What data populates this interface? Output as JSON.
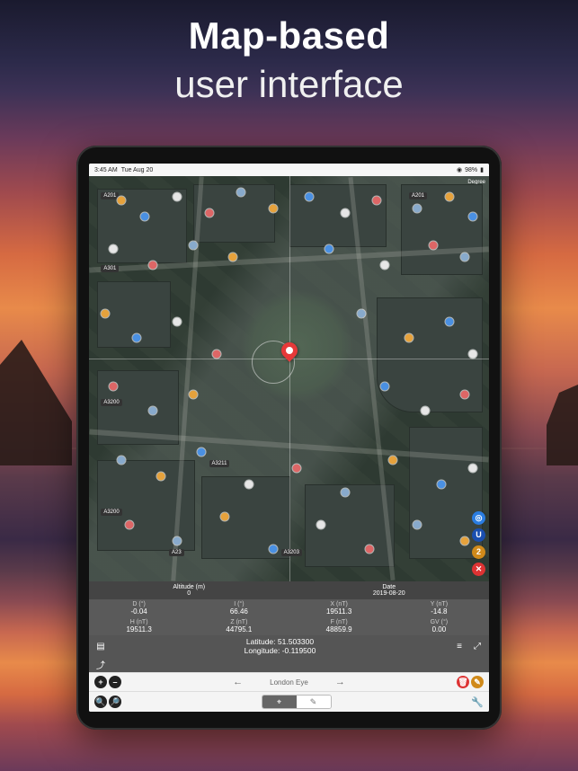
{
  "promo": {
    "title": "Map-based",
    "subtitle": "user interface"
  },
  "status": {
    "time": "3:45 AM",
    "date": "Tue Aug 20",
    "battery": "98%"
  },
  "map": {
    "degree_label": "Degree",
    "road_badges": [
      "A201",
      "A301",
      "A201",
      "A3200",
      "A23",
      "A3203",
      "A3211",
      "A3200"
    ],
    "center_label": "London Eye",
    "side_buttons": {
      "locate": "◎",
      "layers": "U",
      "record": "2",
      "close": "✕"
    }
  },
  "panel": {
    "altitude_label": "Altitude (m)",
    "altitude_value": "0",
    "date_label": "Date",
    "date_value": "2019-08-20",
    "grid": [
      {
        "label": "D (°)",
        "value": "-0.04"
      },
      {
        "label": "I (°)",
        "value": "66.46"
      },
      {
        "label": "X (nT)",
        "value": "19511.3"
      },
      {
        "label": "Y (nT)",
        "value": "-14.8"
      },
      {
        "label": "H (nT)",
        "value": "19511.3"
      },
      {
        "label": "Z (nT)",
        "value": "44795.1"
      },
      {
        "label": "F (nT)",
        "value": "48859.9"
      },
      {
        "label": "GV (°)",
        "value": "0.00"
      }
    ]
  },
  "coords": {
    "lat_label": "Latitude:",
    "lat_value": "51.503300",
    "lon_label": "Longitude:",
    "lon_value": "-0.119500"
  },
  "nav": {
    "location_name": "London Eye"
  },
  "segment": {
    "left": "⌖",
    "right": "✎"
  }
}
